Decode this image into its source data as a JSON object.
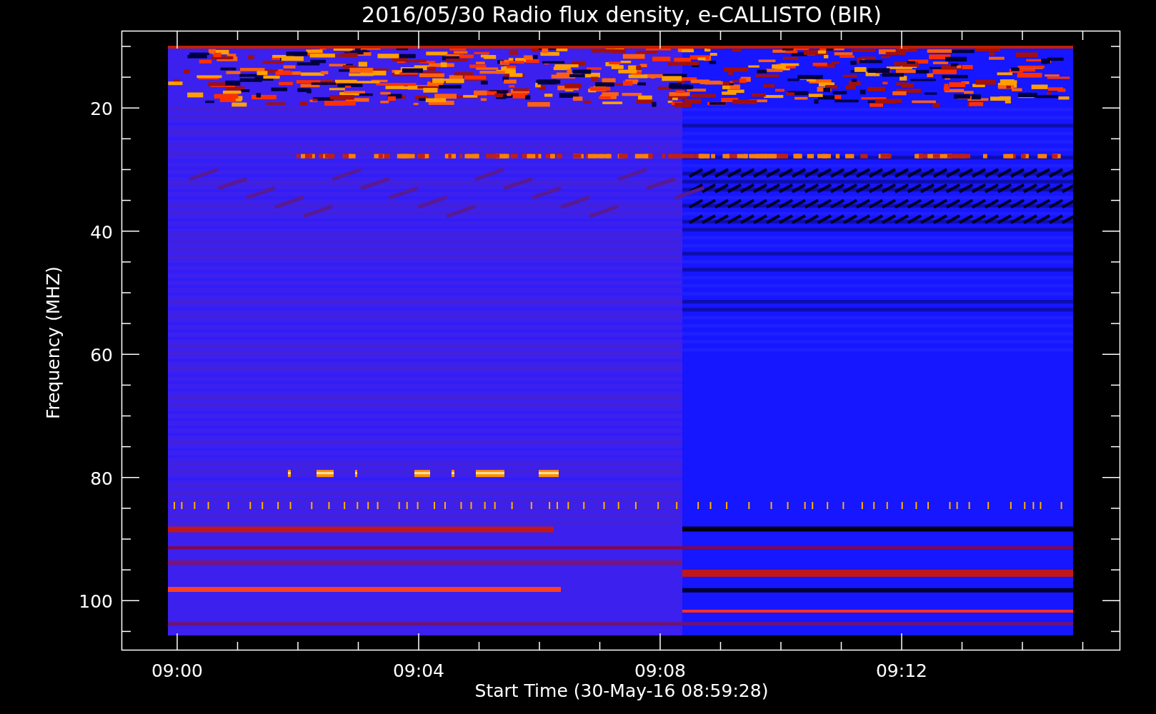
{
  "title": "2016/05/30  Radio flux density, e-CALLISTO (BIR)",
  "y_axis": {
    "label": "Frequency (MHZ)",
    "ticks": [
      "20",
      "40",
      "60",
      "80",
      "100"
    ]
  },
  "x_axis": {
    "label": "Start Time (30-May-16 08:59:28)",
    "ticks": [
      "09:00",
      "09:04",
      "09:08",
      "09:12"
    ]
  }
}
